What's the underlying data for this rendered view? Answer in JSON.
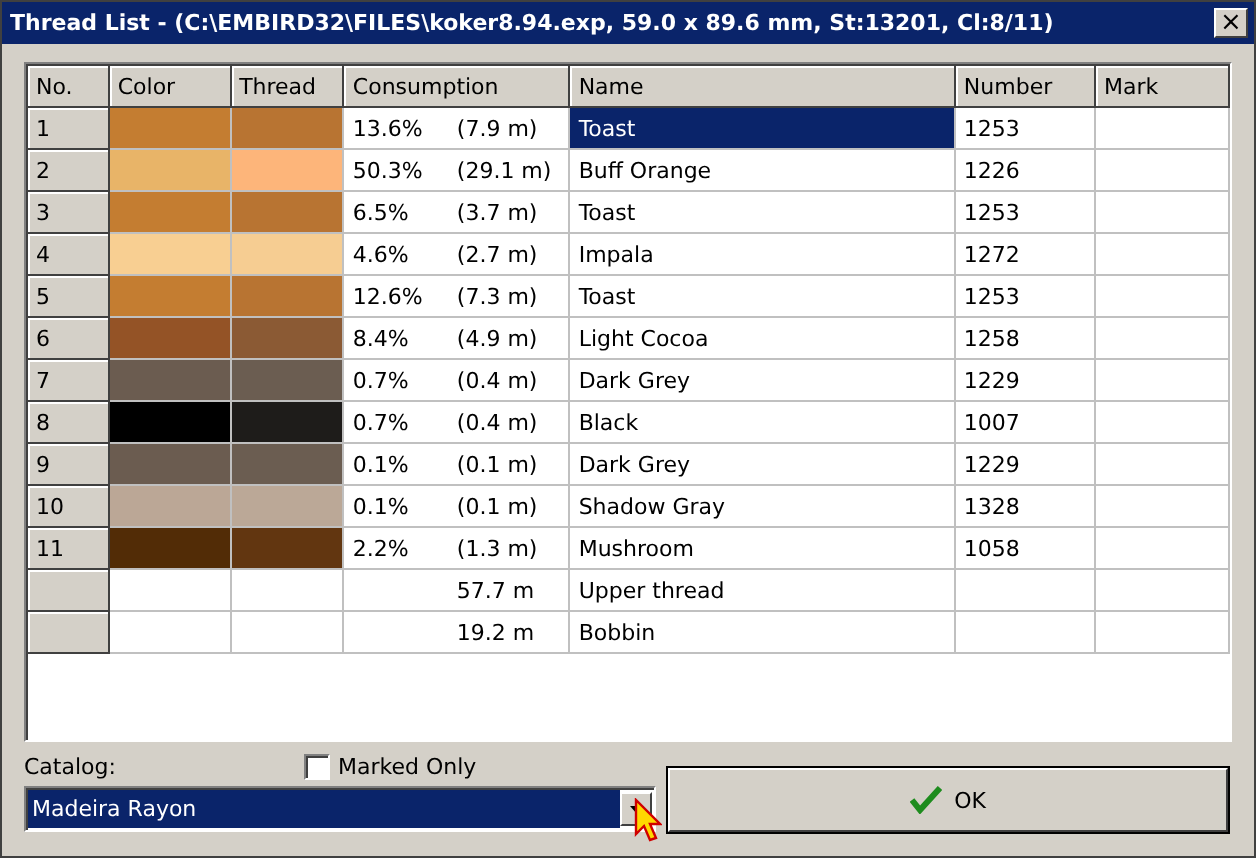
{
  "window": {
    "title": "Thread List - (C:\\EMBIRD32\\FILES\\koker8.94.exp, 59.0 x 89.6 mm, St:13201, Cl:8/11)",
    "close": "×"
  },
  "table": {
    "columns": [
      "No.",
      "Color",
      "Thread",
      "Consumption",
      "Name",
      "Number",
      "Mark"
    ],
    "rows": [
      {
        "kind": "thread",
        "no": "1",
        "swatches": [
          {
            "color": "#c47d31"
          },
          {
            "color": "#b87432"
          }
        ],
        "percent": "13.6%",
        "meters": "(7.9 m)",
        "name": "Toast",
        "number": "1253",
        "selected": true
      },
      {
        "kind": "thread",
        "no": "2",
        "swatches": [
          {
            "color": "#e8b468"
          },
          {
            "color": "#fdb57a"
          }
        ],
        "percent": "50.3%",
        "meters": "(29.1 m)",
        "name": "Buff Orange",
        "number": "1226",
        "selected": false
      },
      {
        "kind": "thread",
        "no": "3",
        "swatches": [
          {
            "color": "#c47d31"
          },
          {
            "color": "#b87432"
          }
        ],
        "percent": "6.5%",
        "meters": "(3.7 m)",
        "name": "Toast",
        "number": "1253",
        "selected": false
      },
      {
        "kind": "thread",
        "no": "4",
        "swatches": [
          {
            "color": "#f8cf92"
          },
          {
            "color": "#f6cd92"
          }
        ],
        "percent": "4.6%",
        "meters": "(2.7 m)",
        "name": "Impala",
        "number": "1272",
        "selected": false
      },
      {
        "kind": "thread",
        "no": "5",
        "swatches": [
          {
            "color": "#c47d31"
          },
          {
            "color": "#b87432"
          }
        ],
        "percent": "12.6%",
        "meters": "(7.3 m)",
        "name": "Toast",
        "number": "1253",
        "selected": false
      },
      {
        "kind": "thread",
        "no": "6",
        "swatches": [
          {
            "color": "#945326"
          },
          {
            "color": "#8b5a34"
          }
        ],
        "percent": "8.4%",
        "meters": "(4.9 m)",
        "name": "Light Cocoa",
        "number": "1258",
        "selected": false
      },
      {
        "kind": "thread",
        "no": "7",
        "swatches": [
          {
            "color": "#6b5c50"
          },
          {
            "color": "#6b5d51"
          }
        ],
        "percent": "0.7%",
        "meters": "(0.4 m)",
        "name": "Dark Grey",
        "number": "1229",
        "selected": false
      },
      {
        "kind": "thread",
        "no": "8",
        "swatches": [
          {
            "color": "#000000"
          },
          {
            "color": "#1e1c1a"
          }
        ],
        "percent": "0.7%",
        "meters": "(0.4 m)",
        "name": "Black",
        "number": "1007",
        "selected": false
      },
      {
        "kind": "thread",
        "no": "9",
        "swatches": [
          {
            "color": "#6b5c50"
          },
          {
            "color": "#6b5d51"
          }
        ],
        "percent": "0.1%",
        "meters": "(0.1 m)",
        "name": "Dark Grey",
        "number": "1229",
        "selected": false
      },
      {
        "kind": "thread",
        "no": "10",
        "swatches": [
          {
            "color": "#bba796"
          },
          {
            "color": "#bba897"
          }
        ],
        "percent": "0.1%",
        "meters": "(0.1 m)",
        "name": "Shadow Gray",
        "number": "1328",
        "selected": false
      },
      {
        "kind": "thread",
        "no": "11",
        "swatches": [
          {
            "color": "#522c06"
          },
          {
            "color": "#623610"
          }
        ],
        "percent": "2.2%",
        "meters": "(1.3 m)",
        "name": "Mushroom",
        "number": "1058",
        "selected": false
      },
      {
        "kind": "total",
        "meters": "57.7 m",
        "name": "Upper thread",
        "selected": false
      },
      {
        "kind": "total",
        "meters": "19.2 m",
        "name": "Bobbin",
        "selected": false
      }
    ]
  },
  "catalog": {
    "label": "Catalog:",
    "value": "Madeira Rayon"
  },
  "marked_only": {
    "label": "Marked Only",
    "checked": false
  },
  "ok_button": {
    "label": "OK"
  }
}
